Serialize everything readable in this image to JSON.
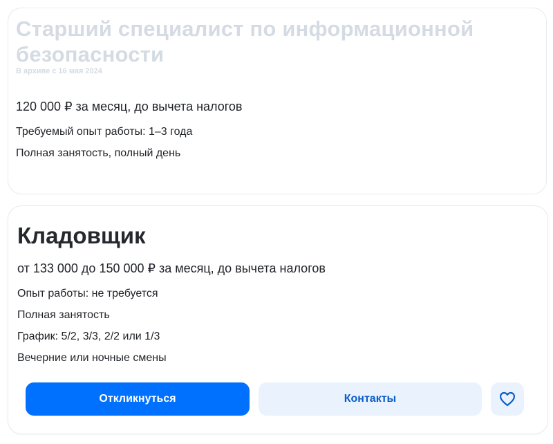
{
  "vacancies": [
    {
      "title": "Старший специалист по информационной безопасности",
      "status": "В архиве с 16 мая 2024",
      "salary": "120 000 ₽ за месяц, до вычета налогов",
      "details": [
        "Требуемый опыт работы: 1–3 года",
        "Полная занятость, полный день"
      ]
    },
    {
      "title": "Кладовщик",
      "salary": "от 133 000 до 150 000 ₽ за месяц, до вычета налогов",
      "details": [
        "Опыт работы: не требуется",
        "Полная занятость",
        "График: 5/2, 3/3, 2/2 или 1/3",
        "Вечерние или ночные смены"
      ],
      "actions": {
        "respond_label": "Откликнуться",
        "contacts_label": "Контакты",
        "favorite_icon": "heart-outline-icon"
      }
    }
  ],
  "colors": {
    "primary": "#0070ff",
    "secondary_bg": "#eaf3fd",
    "secondary_text": "#0b5cc8",
    "archived_text": "#d5dbe3",
    "body_text": "#1f2227"
  }
}
